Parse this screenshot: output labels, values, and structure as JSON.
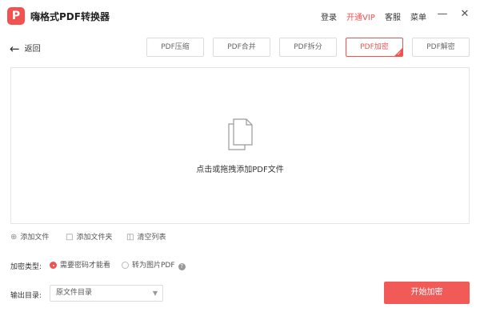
{
  "app": {
    "title": "嗨格式PDF转换器",
    "logo_glyph": "P",
    "accent_color": "#f0524f"
  },
  "titlebar": {
    "login": "登录",
    "vip": "开通VIP",
    "support": "客服",
    "menu": "菜单",
    "minimize_icon": "minimize-icon",
    "close_icon": "close-icon"
  },
  "back": {
    "label": "返回",
    "icon": "arrow-left-icon"
  },
  "tabs": [
    {
      "label": "PDF压缩",
      "active": false
    },
    {
      "label": "PDF合并",
      "active": false
    },
    {
      "label": "PDF拆分",
      "active": false
    },
    {
      "label": "PDF加密",
      "active": true
    },
    {
      "label": "PDF解密",
      "active": false
    }
  ],
  "dropzone": {
    "hint": "点击或拖拽添加PDF文件",
    "icon": "document-stack-icon"
  },
  "actions": {
    "add_file": "添加文件",
    "add_folder": "添加文件夹",
    "clear_list": "清空列表"
  },
  "options": {
    "label": "加密类型:",
    "choices": [
      {
        "label": "需要密码才能看",
        "checked": true
      },
      {
        "label": "转为图片PDF",
        "checked": false
      }
    ],
    "help_glyph": "?"
  },
  "output": {
    "label": "输出目录:",
    "selected": "原文件目录"
  },
  "start_button": "开始加密"
}
